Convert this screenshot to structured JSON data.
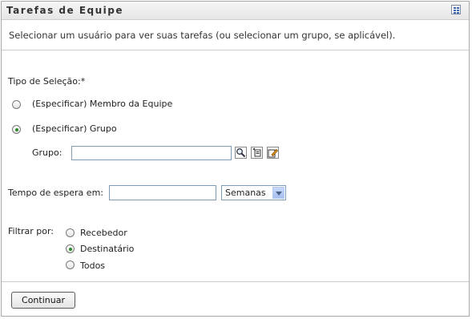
{
  "panel": {
    "title": "Tarefas de Equipe",
    "title_icon": "grid-menu-icon",
    "description": "Selecionar um usuário para ver suas tarefas (ou selecionar um grupo, se aplicável)."
  },
  "selection": {
    "label": "Tipo de Seleção:*",
    "options": [
      {
        "label": "(Especificar) Membro da Equipe",
        "checked": false
      },
      {
        "label": "(Especificar) Grupo",
        "checked": true
      }
    ]
  },
  "group": {
    "label": "Grupo:",
    "value": "",
    "icons": [
      "search-lookup-icon",
      "history-icon",
      "edit-list-icon"
    ]
  },
  "wait": {
    "label": "Tempo de espera em:",
    "value": "",
    "unit_selected": "Semanas"
  },
  "filter": {
    "label": "Filtrar por:",
    "options": [
      {
        "label": "Recebedor",
        "checked": false
      },
      {
        "label": "Destinatário",
        "checked": true
      },
      {
        "label": "Todos",
        "checked": false
      }
    ]
  },
  "actions": {
    "continue_label": "Continuar"
  },
  "colors": {
    "radio_checked": "#2d8a2d",
    "input_border": "#7f9db9",
    "select_arrow": "#a6c0f0"
  }
}
